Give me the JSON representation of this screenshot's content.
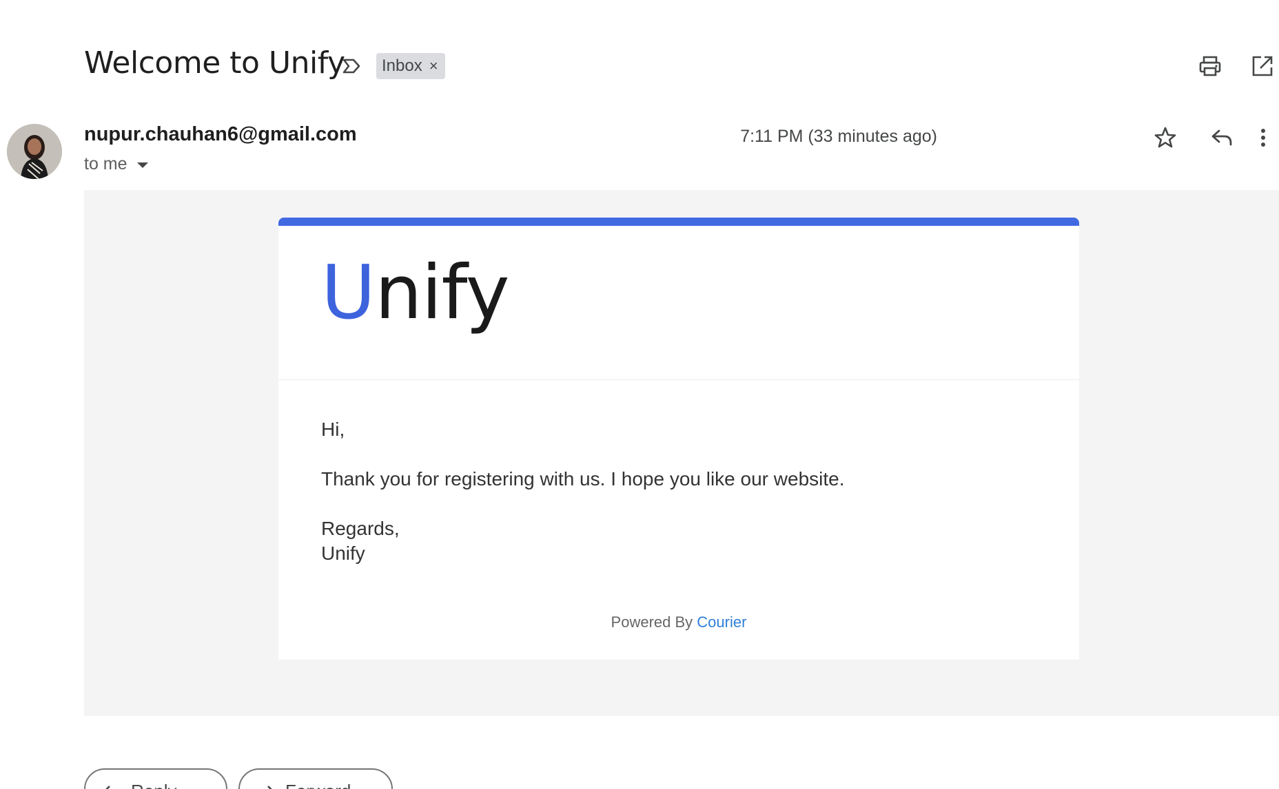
{
  "email": {
    "subject": "Welcome to Unify",
    "label_chip": "Inbox",
    "label_remove_glyph": "×",
    "sender": "nupur.chauhan6@gmail.com",
    "recipient": "to me",
    "timestamp": "7:11 PM (33 minutes ago)"
  },
  "message": {
    "logo_initial": "U",
    "logo_rest": "nify",
    "greeting": "Hi,",
    "body": "Thank you for registering with us. I hope you like our website.",
    "signoff": "Regards,",
    "signature": "Unify",
    "powered_by": "Powered By",
    "powered_link": "Courier"
  },
  "actions": {
    "reply": "Reply",
    "forward": "Forward"
  },
  "icons": {
    "label": "label-outline-icon",
    "print": "print-icon",
    "open_new": "open-in-new-icon",
    "star": "star-outline-icon",
    "reply": "reply-icon",
    "more": "more-vert-icon"
  },
  "colors": {
    "accent_bar": "#4169e1",
    "logo_u": "#3d63dd",
    "link": "#2f7fd8",
    "email_background": "#f4f4f4",
    "chip_background": "#dadce0"
  }
}
